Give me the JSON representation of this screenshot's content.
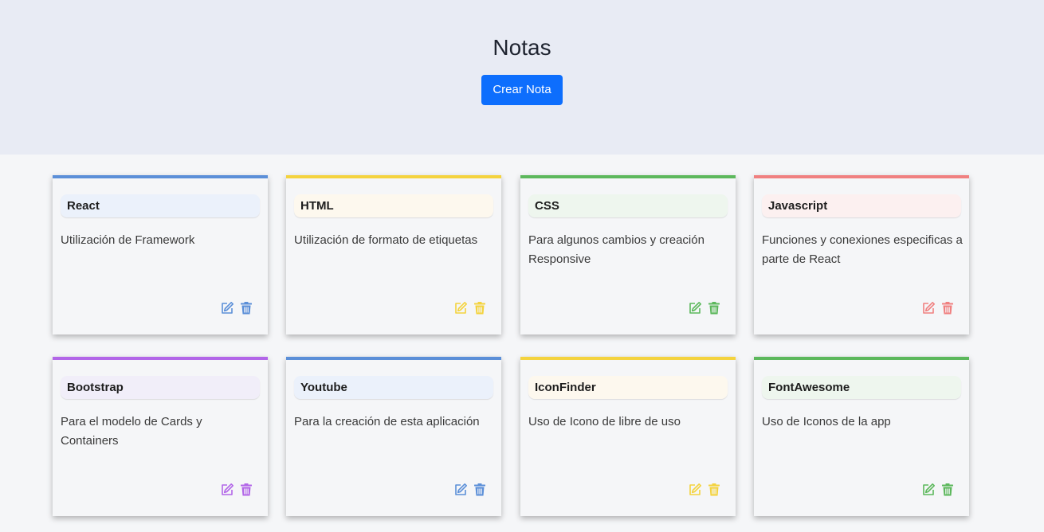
{
  "header": {
    "title": "Notas",
    "create_button": "Crear Nota"
  },
  "colors": {
    "blue": "#5b8fd8",
    "yellow": "#f4d33e",
    "green": "#5cb85c",
    "red": "#f08080",
    "purple": "#b266e8"
  },
  "notes": [
    {
      "title": "React",
      "text": "Utilización de Framework",
      "color": "#5b8fd8",
      "tint": "#ebf1fb"
    },
    {
      "title": "HTML",
      "text": "Utilización de formato de etiquetas",
      "color": "#f4d33e",
      "tint": "#fdf8ee"
    },
    {
      "title": "CSS",
      "text": "Para algunos cambios y creación Responsive",
      "color": "#5cb85c",
      "tint": "#eef6ee"
    },
    {
      "title": "Javascript",
      "text": "Funciones y conexiones especificas a parte de React",
      "color": "#f08080",
      "tint": "#fcf0f0"
    },
    {
      "title": "Bootstrap",
      "text": "Para el modelo de Cards y Containers",
      "color": "#b266e8",
      "tint": "#f1eef9"
    },
    {
      "title": "Youtube",
      "text": "Para la creación de esta aplicación",
      "color": "#5b8fd8",
      "tint": "#ebf1fb"
    },
    {
      "title": "IconFinder",
      "text": "Uso de Icono de libre de uso",
      "color": "#f4d33e",
      "tint": "#fdf8ee"
    },
    {
      "title": "FontAwesome",
      "text": "Uso de Iconos de la app",
      "color": "#5cb85c",
      "tint": "#eef6ee"
    }
  ]
}
